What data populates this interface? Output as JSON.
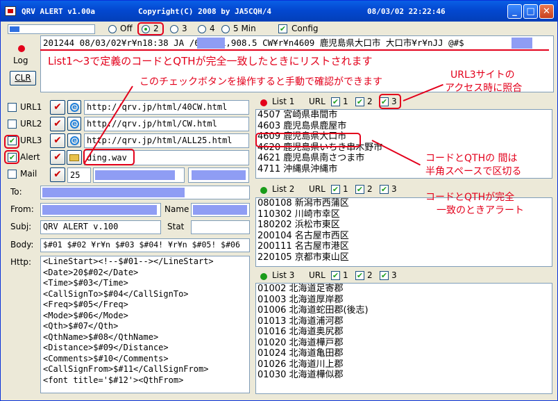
{
  "window": {
    "app_name": "QRV ALERT  v1.00a",
    "copyright": "Copyright(C) 2008 by JA5CQH/4",
    "datetime": "08/03/02 22:22:46",
    "min_icon": "minimize-icon",
    "max_icon": "maximize-icon",
    "close_icon": "close-icon"
  },
  "toolbar": {
    "progress_fraction": 0.12,
    "interval_options": [
      {
        "label": "Off",
        "selected": false
      },
      {
        "label": "2",
        "selected": true
      },
      {
        "label": "3",
        "selected": false
      },
      {
        "label": "4",
        "selected": false
      },
      {
        "label": "5 Min",
        "selected": false
      }
    ],
    "config_label": "Config",
    "config_checked": true
  },
  "log": {
    "label": "Log",
    "clr_label": "CLR",
    "line": "201244  08/03/02¥r¥n18:38  JA      /6¥r¥n1,908.5  CW¥r¥n4609  鹿児島県大口市   大口市¥r¥nJJ      @#$"
  },
  "urls": [
    {
      "label": "URL1",
      "checked": false,
      "value": "http://qrv.jp/html/40CW.html"
    },
    {
      "label": "URL2",
      "checked": false,
      "value": "http://qrv.jp/html/CW.html"
    },
    {
      "label": "URL3",
      "checked": true,
      "value": "http://qrv.jp/html/ALL25.html"
    }
  ],
  "alert": {
    "label": "Alert",
    "checked": true,
    "value": "ding.wav"
  },
  "mail": {
    "label": "Mail",
    "checked": false,
    "port": "25"
  },
  "fields": {
    "to_label": "To:",
    "from_label": "From:",
    "name_label": "Name",
    "subj_label": "Subj:",
    "subj_value": "QRV ALERT v.100",
    "stat_label": "Stat",
    "body_label": "Body:",
    "body_value": "$#01 $#02 ¥r¥n $#03 $#04! ¥r¥n $#05! $#06",
    "http_label": "Http:"
  },
  "http_lines": [
    "<LineStart><!--$#01--></LineStart>",
    "<Date>20$#02</Date>",
    "<Time>$#03</Time>",
    "<CallSignTo>$#04</CallSignTo>",
    "<Freq>$#05</Freq>",
    "<Mode>$#06</Mode>",
    "<Qth>$#07</Qth>",
    "<QthName>$#08</QthName>",
    "<Distance>$#09</Distance>",
    "<Comments>$#10</Comments>",
    "<CallSignFrom>$#11</CallSignFrom>",
    "<font title='$#12'><QthFrom>"
  ],
  "lists": [
    {
      "title": "List 1",
      "dot_color": "#e3001b",
      "url_label": "URL",
      "checks": [
        {
          "label": "1",
          "checked": true
        },
        {
          "label": "2",
          "checked": true
        },
        {
          "label": "3",
          "checked": true
        }
      ],
      "items": [
        "4507 宮崎県串間市",
        "4603 鹿児島県鹿屋市",
        "4609 鹿児島県大口市",
        "4620 鹿児島県いちき串木野市",
        "4621 鹿児島県南さつま市",
        "4711 沖縄県沖縄市"
      ]
    },
    {
      "title": "List 2",
      "dot_color": "#1a9c1a",
      "url_label": "URL",
      "checks": [
        {
          "label": "1",
          "checked": true
        },
        {
          "label": "2",
          "checked": true
        },
        {
          "label": "3",
          "checked": true
        }
      ],
      "items": [
        "080108 新潟市西蒲区",
        "110302 川崎市幸区",
        "180202 浜松市東区",
        "200104 名古屋市西区",
        "200111 名古屋市港区",
        "220105 京都市東山区"
      ]
    },
    {
      "title": "List 3",
      "dot_color": "#1a9c1a",
      "url_label": "URL",
      "checks": [
        {
          "label": "1",
          "checked": true
        },
        {
          "label": "2",
          "checked": true
        },
        {
          "label": "3",
          "checked": true
        }
      ],
      "items": [
        "01002 北海道足寄郡",
        "01003 北海道厚岸郡",
        "01006 北海道蛇田郡(後志)",
        "01013 北海道浦河郡",
        "01016 北海道奥尻郡",
        "01020 北海道樺戸郡",
        "01024 北海道亀田郡",
        "01026 北海道川上郡",
        "01030 北海道樺似郡"
      ]
    }
  ],
  "annotations": {
    "a1": "List1～3で定義のコードとQTHが完全一致したときにリストされます",
    "a2": "このチェックボタンを操作すると手動で確認ができます",
    "a3_line1": "URL3サイトの",
    "a3_line2": "アクセス時に照合",
    "a4_line1": "コードとQTHの 間は",
    "a4_line2": "半角スペースで区切る",
    "a5_line1": "コードとQTHが完全",
    "a5_line2": "一致のときアラート"
  },
  "colors": {
    "annotation": "#e3001b",
    "redacted": "#8f9df4"
  }
}
